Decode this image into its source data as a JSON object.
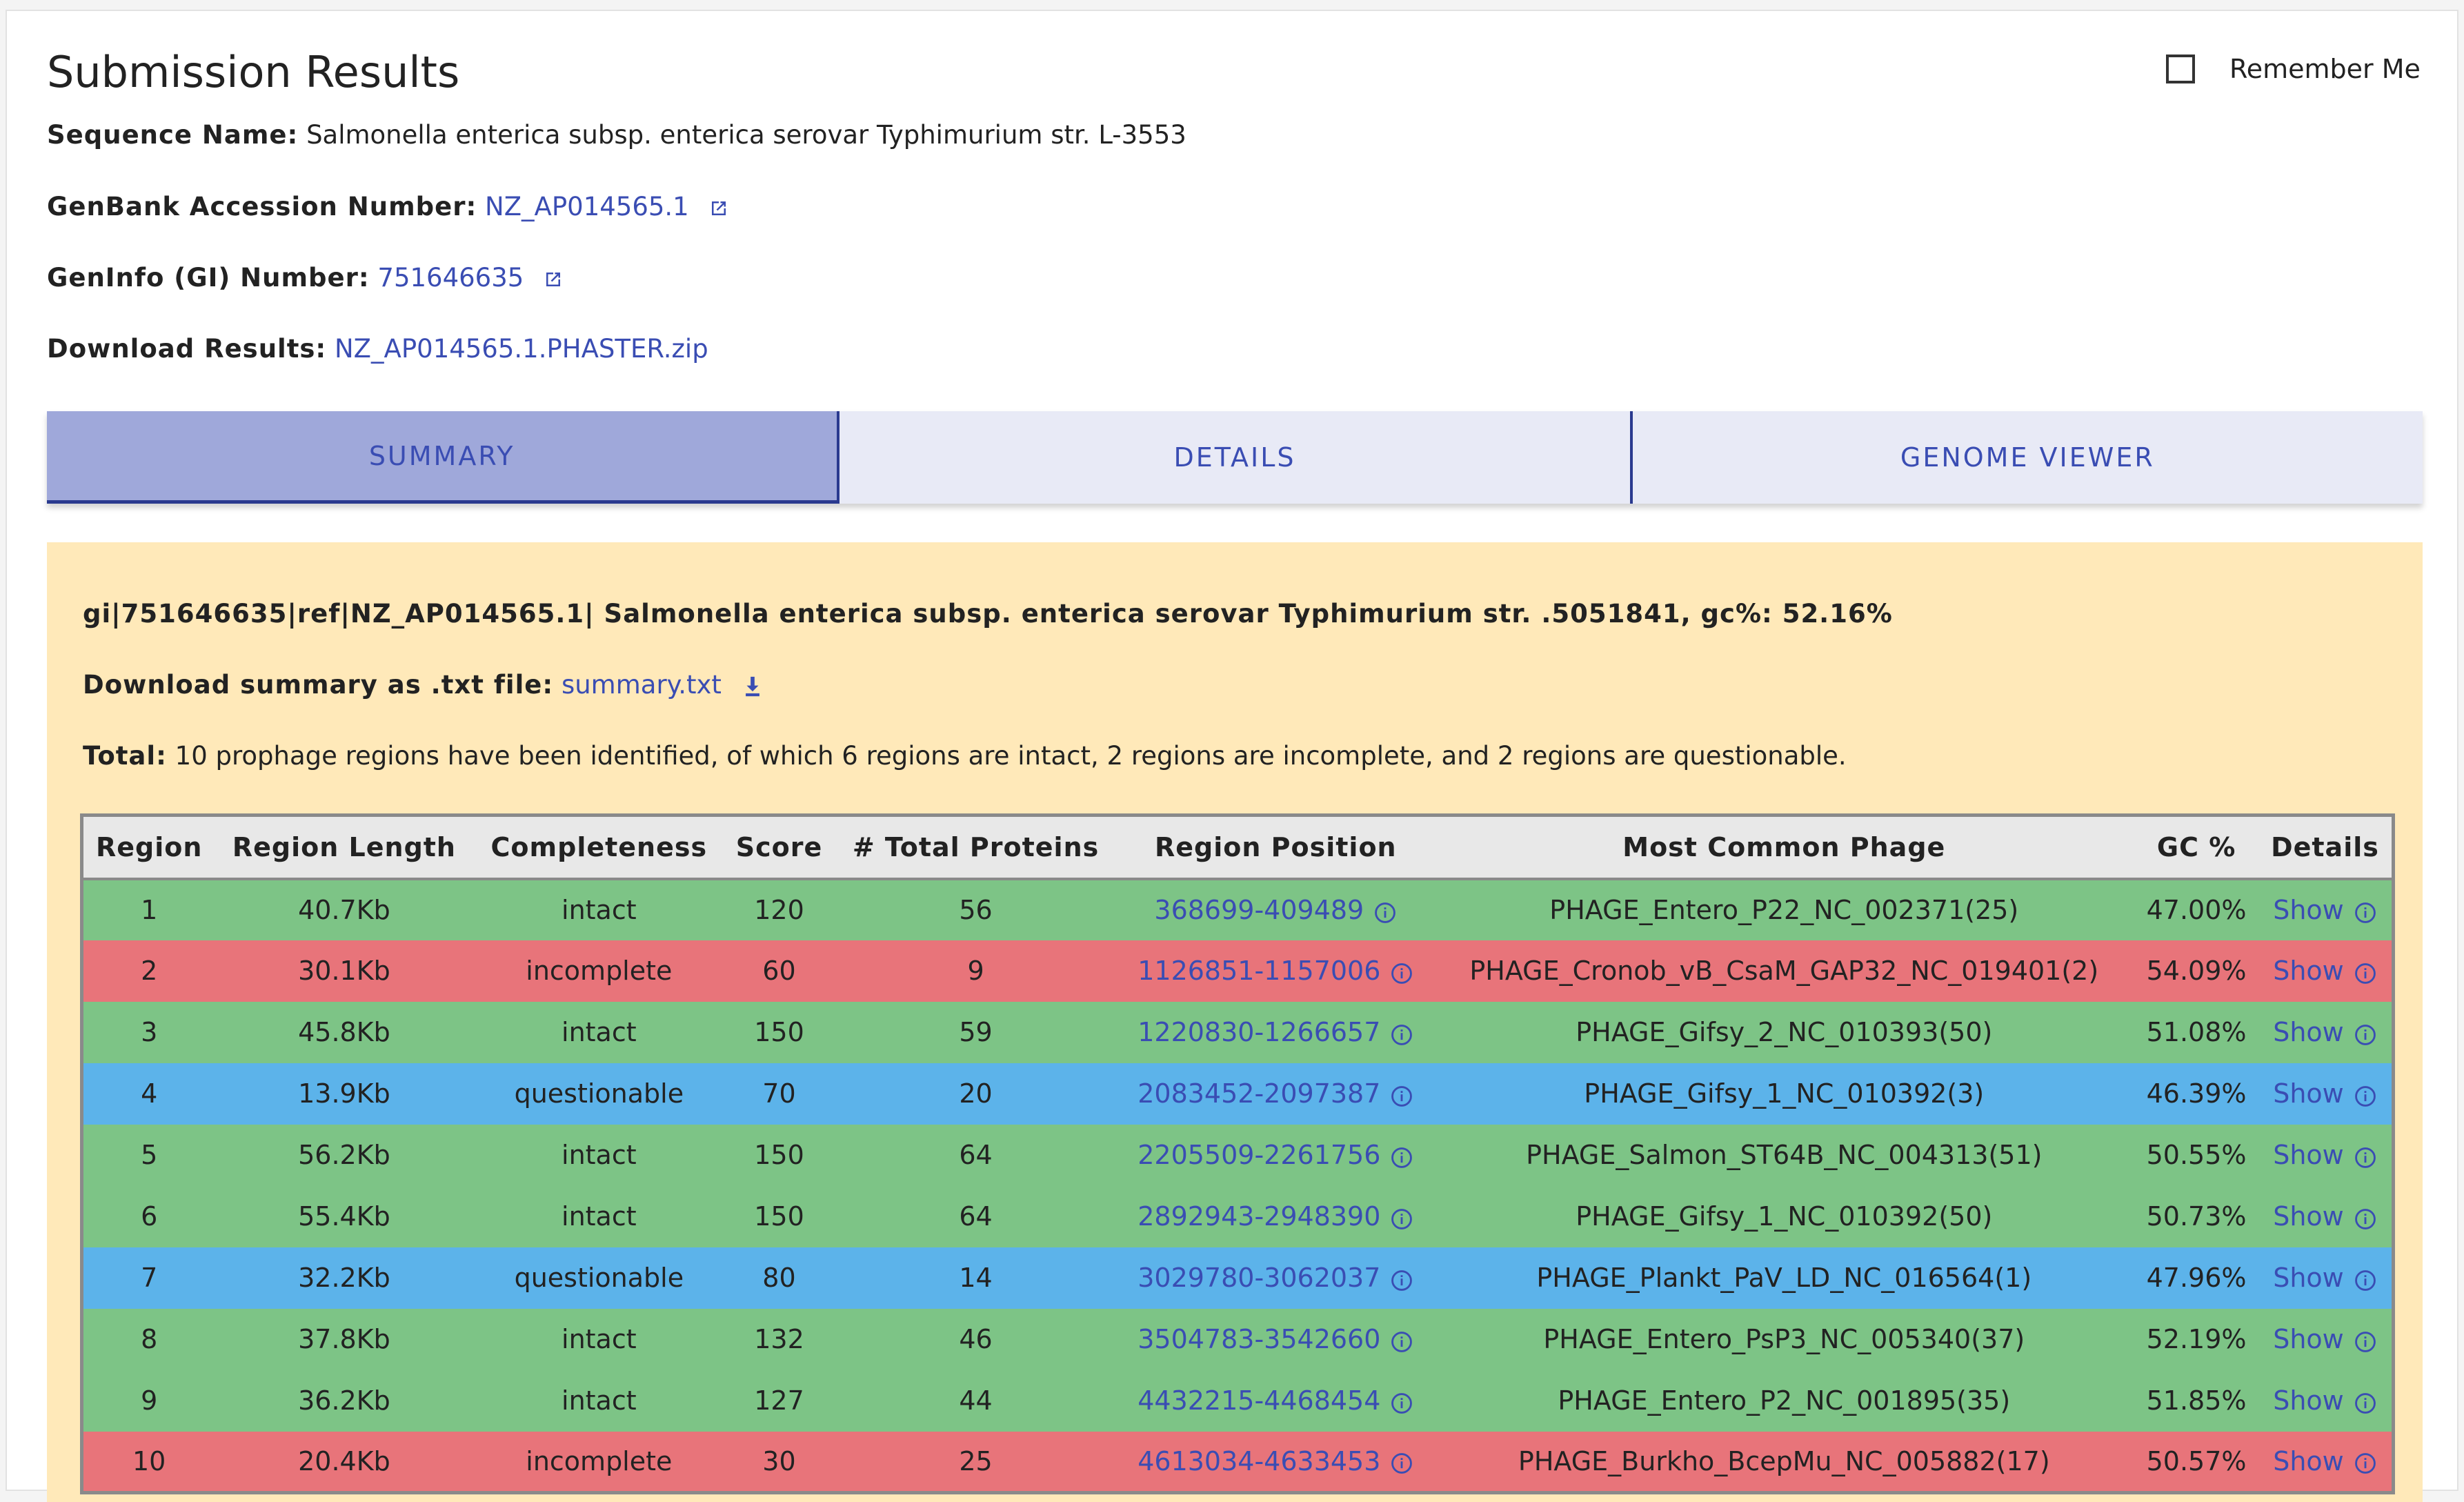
{
  "page": {
    "title": "Submission Results",
    "remember_label": "Remember Me"
  },
  "info": {
    "sequence_label": "Sequence Name:",
    "sequence_value": "Salmonella enterica subsp. enterica serovar Typhimurium str. L-3553",
    "genbank_label": "GenBank Accession Number:",
    "genbank_value": "NZ_AP014565.1",
    "gi_label": "GenInfo (GI) Number:",
    "gi_value": "751646635",
    "download_label": "Download Results:",
    "download_value": "NZ_AP014565.1.PHASTER.zip"
  },
  "tabs": [
    {
      "label": "SUMMARY",
      "active": true
    },
    {
      "label": "DETAILS",
      "active": false
    },
    {
      "label": "GENOME VIEWER",
      "active": false
    }
  ],
  "summary": {
    "header_line": "gi|751646635|ref|NZ_AP014565.1| Salmonella enterica subsp. enterica serovar Typhimurium str. .5051841, gc%: 52.16%",
    "download_label": "Download summary as .txt file:",
    "download_link": "summary.txt",
    "total_label": "Total:",
    "total_text": "10 prophage regions have been identified, of which 6 regions are intact, 2 regions are incomplete, and 2 regions are questionable."
  },
  "table": {
    "columns": [
      "Region",
      "Region Length",
      "Completeness",
      "Score",
      "# Total Proteins",
      "Region Position",
      "Most Common Phage",
      "GC %",
      "Details"
    ],
    "rows": [
      {
        "region": "1",
        "length": "40.7Kb",
        "completeness": "intact",
        "score": "120",
        "proteins": "56",
        "position": "368699-409489",
        "phage": "PHAGE_Entero_P22_NC_002371(25)",
        "gc": "47.00%",
        "details": "Show"
      },
      {
        "region": "2",
        "length": "30.1Kb",
        "completeness": "incomplete",
        "score": "60",
        "proteins": "9",
        "position": "1126851-1157006",
        "phage": "PHAGE_Cronob_vB_CsaM_GAP32_NC_019401(2)",
        "gc": "54.09%",
        "details": "Show"
      },
      {
        "region": "3",
        "length": "45.8Kb",
        "completeness": "intact",
        "score": "150",
        "proteins": "59",
        "position": "1220830-1266657",
        "phage": "PHAGE_Gifsy_2_NC_010393(50)",
        "gc": "51.08%",
        "details": "Show"
      },
      {
        "region": "4",
        "length": "13.9Kb",
        "completeness": "questionable",
        "score": "70",
        "proteins": "20",
        "position": "2083452-2097387",
        "phage": "PHAGE_Gifsy_1_NC_010392(3)",
        "gc": "46.39%",
        "details": "Show"
      },
      {
        "region": "5",
        "length": "56.2Kb",
        "completeness": "intact",
        "score": "150",
        "proteins": "64",
        "position": "2205509-2261756",
        "phage": "PHAGE_Salmon_ST64B_NC_004313(51)",
        "gc": "50.55%",
        "details": "Show"
      },
      {
        "region": "6",
        "length": "55.4Kb",
        "completeness": "intact",
        "score": "150",
        "proteins": "64",
        "position": "2892943-2948390",
        "phage": "PHAGE_Gifsy_1_NC_010392(50)",
        "gc": "50.73%",
        "details": "Show"
      },
      {
        "region": "7",
        "length": "32.2Kb",
        "completeness": "questionable",
        "score": "80",
        "proteins": "14",
        "position": "3029780-3062037",
        "phage": "PHAGE_Plankt_PaV_LD_NC_016564(1)",
        "gc": "47.96%",
        "details": "Show"
      },
      {
        "region": "8",
        "length": "37.8Kb",
        "completeness": "intact",
        "score": "132",
        "proteins": "46",
        "position": "3504783-3542660",
        "phage": "PHAGE_Entero_PsP3_NC_005340(37)",
        "gc": "52.19%",
        "details": "Show"
      },
      {
        "region": "9",
        "length": "36.2Kb",
        "completeness": "intact",
        "score": "127",
        "proteins": "44",
        "position": "4432215-4468454",
        "phage": "PHAGE_Entero_P2_NC_001895(35)",
        "gc": "51.85%",
        "details": "Show"
      },
      {
        "region": "10",
        "length": "20.4Kb",
        "completeness": "incomplete",
        "score": "30",
        "proteins": "25",
        "position": "4613034-4633453",
        "phage": "PHAGE_Burkho_BcepMu_NC_005882(17)",
        "gc": "50.57%",
        "details": "Show"
      }
    ]
  },
  "colors": {
    "intact": "#7dc486",
    "incomplete": "#e8747a",
    "questionable": "#5cb3ea",
    "link": "#3a4db3",
    "summary_bg": "#ffe9b9",
    "active_tab": "#9fa8da"
  },
  "icons": {
    "external_link": "external-link-icon",
    "download": "download-icon",
    "info": "info-circle-icon"
  }
}
